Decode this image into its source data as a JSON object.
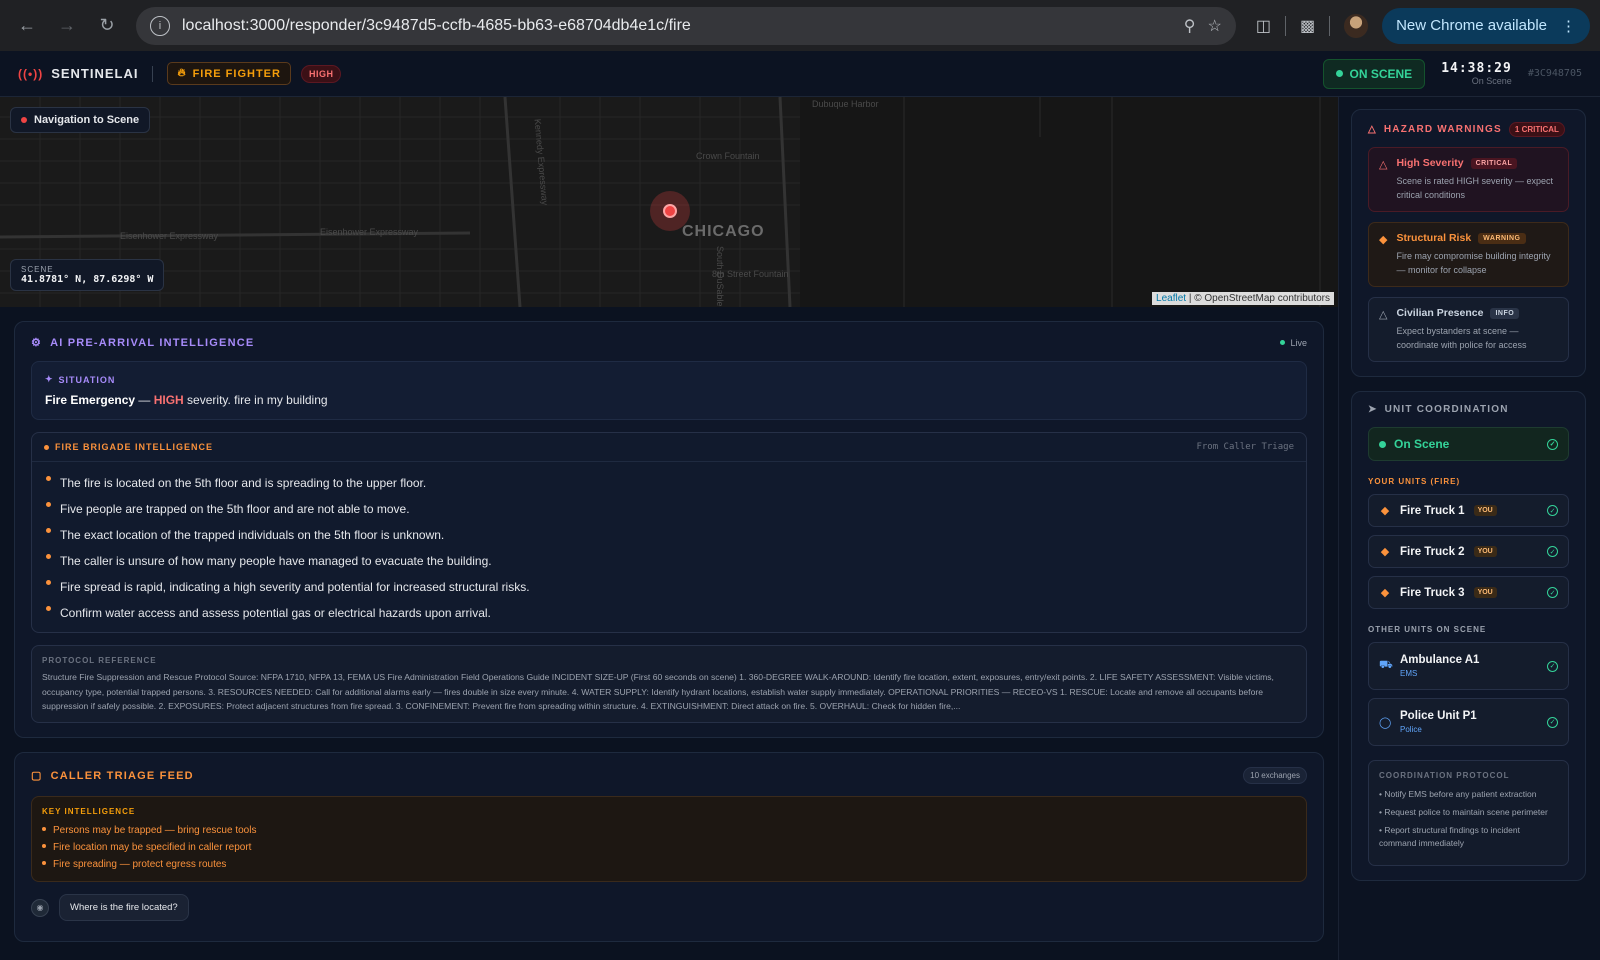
{
  "browser": {
    "url": "localhost:3000/responder/3c9487d5-ccfb-4685-bb63-e68704db4e1c/fire",
    "update_label": "New Chrome available"
  },
  "header": {
    "brand": "SENTINELAI",
    "role": "FIRE FIGHTER",
    "severity": "HIGH",
    "status": "ON SCENE",
    "time": "14:38:29",
    "time_sub": "On Scene",
    "incident_id": "#3C948705"
  },
  "map": {
    "nav_label": "Navigation to Scene",
    "scene_label": "SCENE",
    "scene_coords": "41.8781° N, 87.6298° W",
    "city": "CHICAGO",
    "attribution_leaflet": "Leaflet",
    "attribution_rest": " | © OpenStreetMap contributors",
    "labels": [
      "Eisenhower Expressway",
      "Eisenhower Expressway",
      "Kennedy Expressway",
      "Crown Fountain",
      "Dubuque Harbor",
      "South DuSable Lake Shore Drive",
      "8th Street Fountain"
    ]
  },
  "intel": {
    "title": "AI PRE-ARRIVAL INTELLIGENCE",
    "live": "Live",
    "situation_label": "SITUATION",
    "situation_type": "Fire Emergency",
    "situation_dash": " — ",
    "situation_sev": "HIGH",
    "situation_rest": " severity. fire in my building",
    "brigade_title": "FIRE BRIGADE INTELLIGENCE",
    "brigade_source": "From Caller Triage",
    "brigade_items": [
      "The fire is located on the 5th floor and is spreading to the upper floor.",
      "Five people are trapped on the 5th floor and are not able to move.",
      "The exact location of the trapped individuals on the 5th floor is unknown.",
      "The caller is unsure of how many people have managed to evacuate the building.",
      "Fire spread is rapid, indicating a high severity and potential for increased structural risks.",
      "Confirm water access and assess potential gas or electrical hazards upon arrival."
    ],
    "protocol_label": "PROTOCOL REFERENCE",
    "protocol_text": "Structure Fire Suppression and Rescue Protocol Source: NFPA 1710, NFPA 13, FEMA US Fire Administration Field Operations Guide INCIDENT SIZE-UP (First 60 seconds on scene) 1. 360-DEGREE WALK-AROUND: Identify fire location, extent, exposures, entry/exit points. 2. LIFE SAFETY ASSESSMENT: Visible victims, occupancy type, potential trapped persons. 3. RESOURCES NEEDED: Call for additional alarms early — fires double in size every minute. 4. WATER SUPPLY: Identify hydrant locations, establish water supply immediately. OPERATIONAL PRIORITIES — RECEO-VS 1. RESCUE: Locate and remove all occupants before suppression if safely possible. 2. EXPOSURES: Protect adjacent structures from fire spread. 3. CONFINEMENT: Prevent fire from spreading within structure. 4. EXTINGUISHMENT: Direct attack on fire. 5. OVERHAUL: Check for hidden fire,..."
  },
  "triage": {
    "title": "CALLER TRIAGE FEED",
    "exchanges": "10 exchanges",
    "key_label": "KEY INTELLIGENCE",
    "key_items": [
      "Persons may be trapped — bring rescue tools",
      "Fire location may be specified in caller report",
      "Fire spreading — protect egress routes"
    ],
    "first_message": "Where is the fire located?"
  },
  "hazards": {
    "title": "HAZARD WARNINGS",
    "count": "1 CRITICAL",
    "items": [
      {
        "title": "High Severity",
        "tag": "CRITICAL",
        "desc": "Scene is rated HIGH severity — expect critical conditions"
      },
      {
        "title": "Structural Risk",
        "tag": "WARNING",
        "desc": "Fire may compromise building integrity — monitor for collapse"
      },
      {
        "title": "Civilian Presence",
        "tag": "INFO",
        "desc": "Expect bystanders at scene — coordinate with police for access"
      }
    ]
  },
  "units": {
    "title": "UNIT COORDINATION",
    "status": "On Scene",
    "your_label": "YOUR UNITS (FIRE)",
    "your_units": [
      {
        "name": "Fire Truck 1",
        "tag": "YOU"
      },
      {
        "name": "Fire Truck 2",
        "tag": "YOU"
      },
      {
        "name": "Fire Truck 3",
        "tag": "YOU"
      }
    ],
    "other_label": "OTHER UNITS ON SCENE",
    "other_units": [
      {
        "name": "Ambulance A1",
        "type": "EMS"
      },
      {
        "name": "Police Unit P1",
        "type": "Police"
      }
    ],
    "protocol_label": "COORDINATION PROTOCOL",
    "protocol_items": [
      "• Notify EMS before any patient extraction",
      "• Request police to maintain scene perimeter",
      "• Report structural findings to incident command immediately"
    ]
  },
  "colors": {
    "accent_fire": "#fb923c",
    "critical": "#f87171",
    "on_scene": "#34d399",
    "intel": "#a78bfa"
  }
}
